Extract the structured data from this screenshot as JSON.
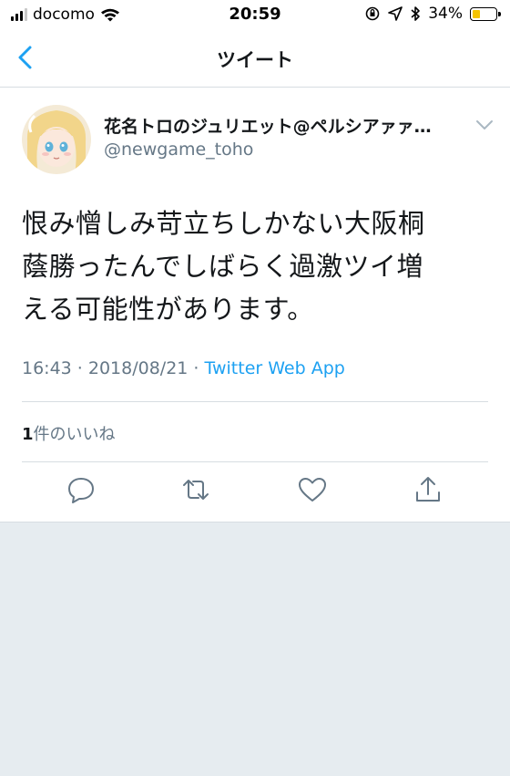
{
  "status_bar": {
    "carrier": "docomo",
    "time": "20:59",
    "battery": "34%",
    "battery_level": 0.34
  },
  "nav": {
    "title": "ツイート"
  },
  "tweet": {
    "display_name": "花名トロのジュリエット@ペルシアァァ…",
    "handle": "@newgame_toho",
    "text_lines": [
      "恨み憎しみ苛立ちしかない大阪桐",
      "蔭勝ったんでしばらく過激ツイ増",
      "える可能性があります。"
    ],
    "timestamp": "16:43 · 2018/08/21 · ",
    "source": "Twitter Web App",
    "like_count": "1",
    "like_label": "件のいいね"
  },
  "colors": {
    "accent": "#1da1f2",
    "secondary_text": "#657786",
    "divider": "#d7dde2",
    "background": "#e6ecf0"
  },
  "icons": {
    "back": "chevron-left-icon",
    "caret": "chevron-down-icon",
    "reply": "reply-icon",
    "retweet": "retweet-icon",
    "like": "heart-icon",
    "share": "share-icon"
  }
}
